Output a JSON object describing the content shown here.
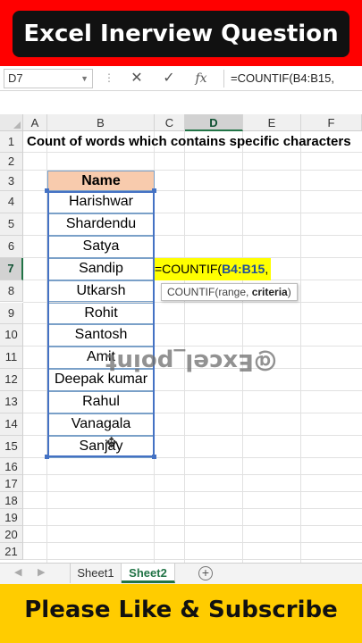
{
  "banner": {
    "title": "Excel Inerview Question",
    "bottom_text": "Please Like & Subscribe",
    "top_color": "#ff0000",
    "bottom_color": "#ffcc00"
  },
  "formula_bar": {
    "name_box": "D7",
    "formula": "=COUNTIF(B4:B15,",
    "cancel_icon": "close-icon",
    "enter_icon": "check-icon",
    "fx_label": "fx"
  },
  "columns": [
    "A",
    "B",
    "C",
    "D",
    "E",
    "F"
  ],
  "active_column": "D",
  "rows": [
    "1",
    "2",
    "3",
    "4",
    "5",
    "6",
    "7",
    "8",
    "9",
    "10",
    "11",
    "12",
    "13",
    "14",
    "15",
    "16",
    "17",
    "18",
    "19",
    "20",
    "21"
  ],
  "active_row": "7",
  "sheet": {
    "row1_text": "Count of words which contains specific characters",
    "table_header": "Name",
    "names": [
      "Harishwar",
      "Shardendu",
      "Satya",
      "Sandip",
      "Utkarsh",
      "Rohit",
      "Santosh",
      "Amit",
      "Deepak kumar",
      "Rahul",
      "Vanagala",
      "Sanjay"
    ],
    "formula_prefix": "=COUNTIF(",
    "formula_ref": "B4:B15",
    "formula_suffix": ",",
    "tooltip_prefix": "COUNTIF(range, ",
    "tooltip_bold": "criteria",
    "tooltip_suffix": ")",
    "watermark": "@Excel_point",
    "header_color": "#f8cbad",
    "highlight_color": "#ffff00"
  },
  "tabs": {
    "items": [
      "Sheet1",
      "Sheet2"
    ],
    "active": "Sheet2",
    "add_label": "+"
  }
}
